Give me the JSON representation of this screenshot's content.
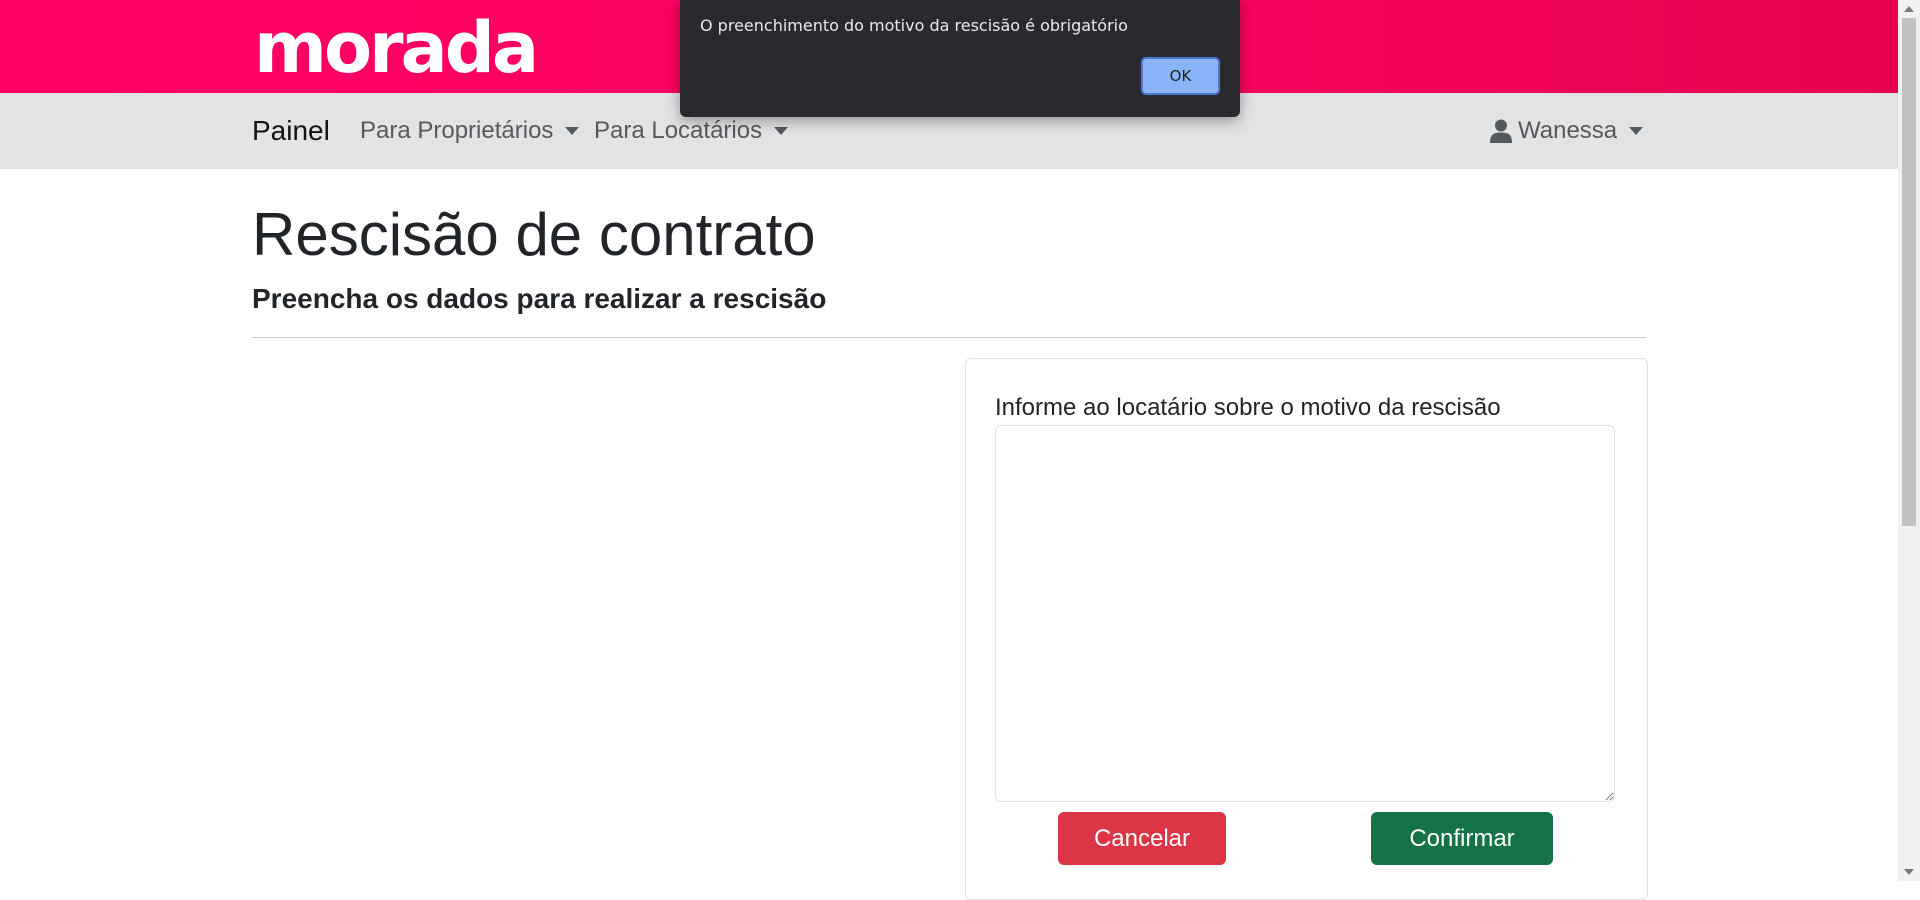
{
  "brand": {
    "logo_text": "morada",
    "color": "#ff0066"
  },
  "navbar": {
    "brand_label": "Painel",
    "items": [
      {
        "label": "Para Proprietários",
        "icon": "caret-down-icon"
      },
      {
        "label": "Para Locatários",
        "icon": "caret-down-icon"
      }
    ],
    "user": {
      "name": "Wanessa",
      "icon": "user-icon"
    }
  },
  "page": {
    "title": "Rescisão de contrato",
    "subtitle": "Preencha os dados para realizar a rescisão"
  },
  "form": {
    "reason_label": "Informe ao locatário sobre o motivo da rescisão",
    "reason_value": "",
    "cancel_label": "Cancelar",
    "confirm_label": "Confirmar",
    "cancel_color": "#dc3545",
    "confirm_color": "#157347"
  },
  "alert": {
    "message": "O preenchimento do motivo da rescisão é obrigatório",
    "ok_label": "OK"
  }
}
